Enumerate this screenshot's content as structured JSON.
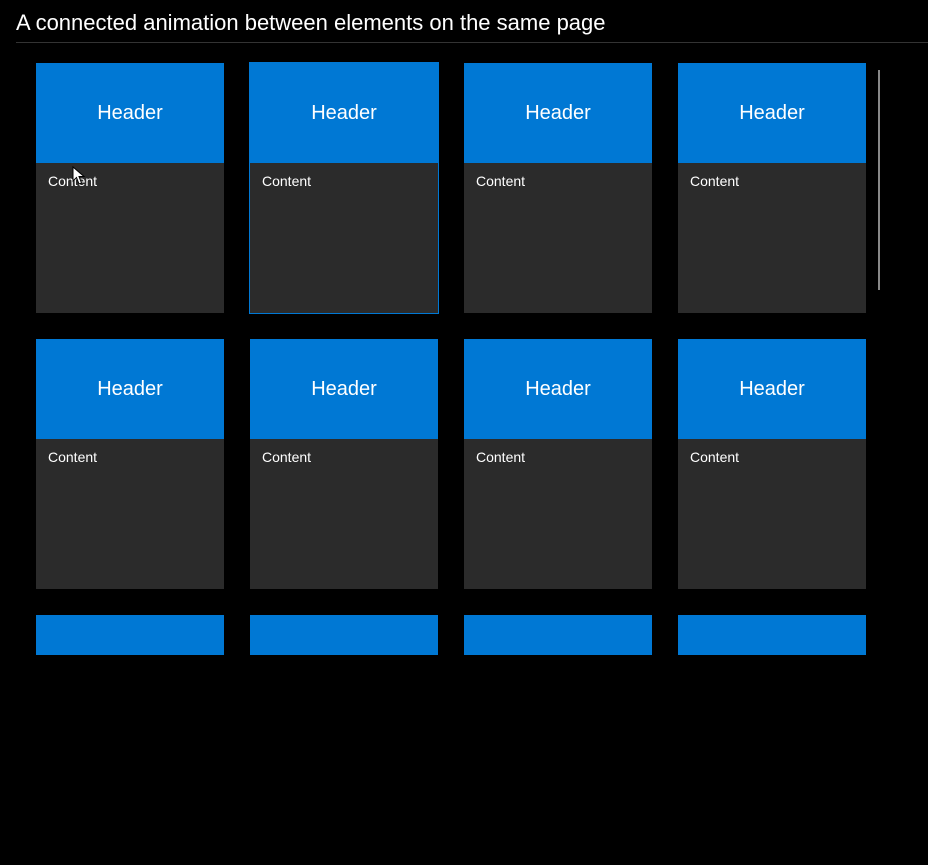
{
  "title": "A connected animation between elements on the same page",
  "card": {
    "header_label": "Header",
    "content_label": "Content"
  },
  "grid": {
    "rows": 3,
    "cols": 4,
    "selected_index": 1
  },
  "colors": {
    "accent": "#0078d4",
    "background": "#000000",
    "card_body": "#2b2b2b"
  }
}
